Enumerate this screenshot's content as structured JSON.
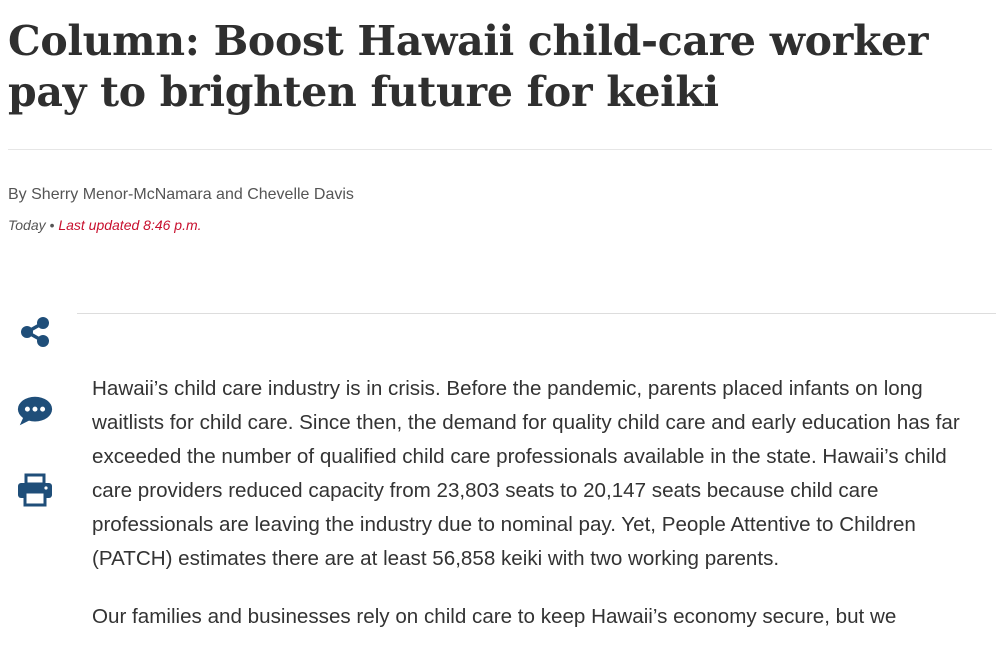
{
  "article": {
    "headline": "Column: Boost Hawaii child-care worker pay to brighten future for keiki",
    "byline": "By Sherry Menor-McNamara and Chevelle Davis",
    "date": "Today",
    "separator": "•",
    "last_updated": "Last updated 8:46 p.m.",
    "paragraphs": [
      "Hawaii’s child care industry is in crisis. Before the pandemic, parents placed infants on long waitlists for child care. Since then, the demand for quality child care and early education has far exceeded the number of qualified child care professionals available in the state. Hawaii’s child care providers reduced capacity from 23,803 seats to 20,147 seats because child care professionals are leaving the industry due to nominal pay. Yet, People Attentive to Children (PATCH) estimates there are at least 56,858 keiki with two working parents.",
      "Our families and businesses rely on child care to keep Hawaii’s economy secure, but we"
    ]
  },
  "tools": [
    {
      "icon": "share-icon"
    },
    {
      "icon": "comment-icon"
    },
    {
      "icon": "print-icon"
    }
  ],
  "colors": {
    "icon": "#1f4e79",
    "updated": "#c8102e",
    "text": "#333333"
  }
}
